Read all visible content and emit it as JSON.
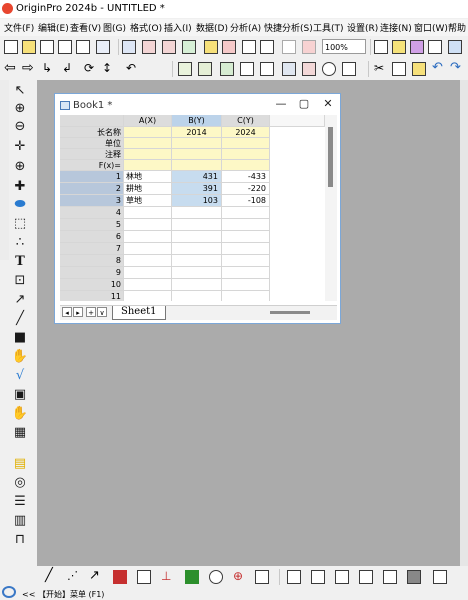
{
  "window": {
    "title": "OriginPro 2024b - UNTITLED *"
  },
  "menu": [
    "文件(F)",
    "编辑(E)",
    "查看(V)",
    "图(G)",
    "格式(O)",
    "插入(I)",
    "数据(D)",
    "分析(A)",
    "快捷分析(S)",
    "工具(T)",
    "设置(R)",
    "连接(N)",
    "窗口(W)",
    "帮助"
  ],
  "toolbar": {
    "zoom": "100%"
  },
  "book": {
    "title": "Book1 *",
    "controls": {
      "minimize": "—",
      "maximize": "▢",
      "close": "✕"
    },
    "columns": [
      "A(X)",
      "B(Y)",
      "C(Y)"
    ],
    "meta_labels": [
      "长名称",
      "单位",
      "注释",
      "F(x)="
    ],
    "long_names": [
      "",
      "2014",
      "2024"
    ],
    "rows": [
      {
        "n": "1",
        "a": "林地",
        "b": "431",
        "c": "-433"
      },
      {
        "n": "2",
        "a": "耕地",
        "b": "391",
        "c": "-220"
      },
      {
        "n": "3",
        "a": "草地",
        "b": "103",
        "c": "-108"
      }
    ],
    "empty_rows": [
      "4",
      "5",
      "6",
      "7",
      "8",
      "9",
      "10",
      "11"
    ],
    "sheet_tab": "Sheet1"
  },
  "status": {
    "text": "<< 【开始】菜单 (F1)"
  },
  "icons": {
    "app": "origin-logo-icon",
    "left_tools": [
      "pointer-icon",
      "zoom-in-icon",
      "zoom-out-icon",
      "pan-icon",
      "data-reader-icon",
      "screen-reader-icon",
      "draw-data-icon",
      "mask-icon",
      "text-icon",
      "insert-graph-icon",
      "arrow-icon",
      "line-icon",
      "rectangle-icon",
      "hand-icon",
      "equation-icon",
      "insert-image-icon"
    ]
  }
}
